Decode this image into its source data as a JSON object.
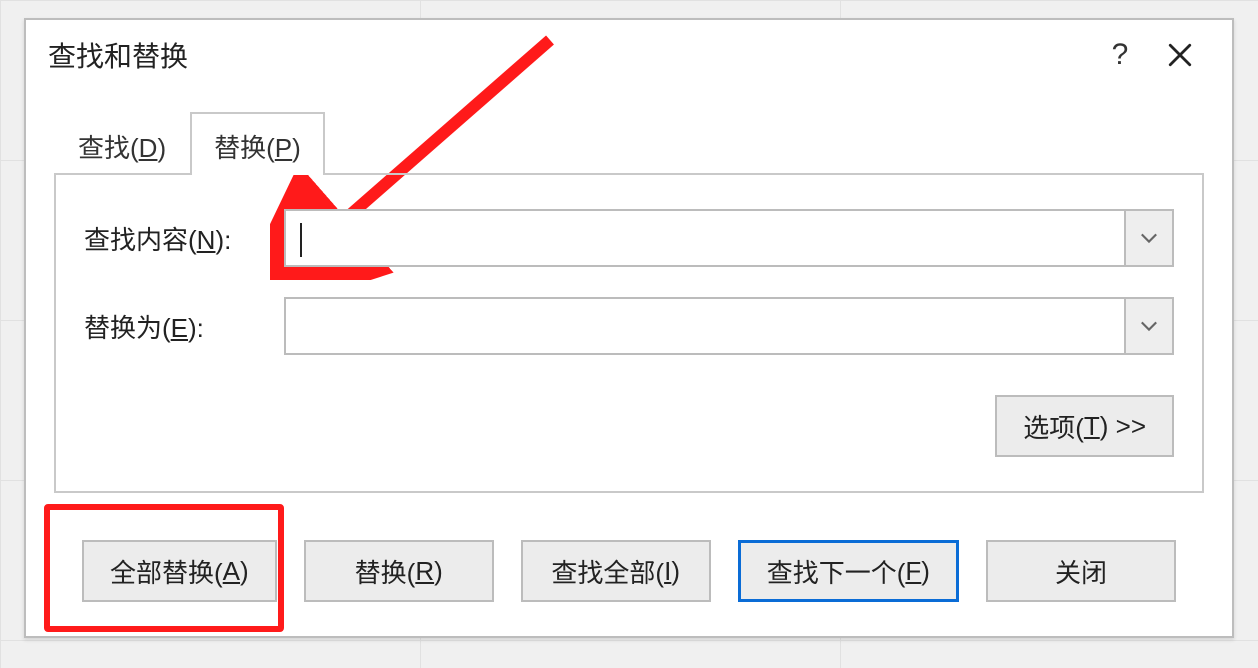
{
  "dialog": {
    "title": "查找和替换",
    "help_symbol": "?",
    "tabs": {
      "find": {
        "label_pre": "查找(",
        "hotkey": "D",
        "label_post": ")"
      },
      "replace": {
        "label_pre": "替换(",
        "hotkey": "P",
        "label_post": ")"
      }
    },
    "fields": {
      "find": {
        "label_pre": "查找内容(",
        "hotkey": "N",
        "label_post": "):",
        "value": ""
      },
      "replace": {
        "label_pre": "替换为(",
        "hotkey": "E",
        "label_post": "):",
        "value": ""
      }
    },
    "options_button": {
      "label_pre": "选项(",
      "hotkey": "T",
      "label_post": ") >>"
    },
    "buttons": {
      "replace_all": {
        "label_pre": "全部替换(",
        "hotkey": "A",
        "label_post": ")"
      },
      "replace": {
        "label_pre": "替换(",
        "hotkey": "R",
        "label_post": ")"
      },
      "find_all": {
        "label_pre": "查找全部(",
        "hotkey": "I",
        "label_post": ")"
      },
      "find_next": {
        "label_pre": "查找下一个(",
        "hotkey": "F",
        "label_post": ")"
      },
      "close": {
        "label": "关闭"
      }
    }
  }
}
